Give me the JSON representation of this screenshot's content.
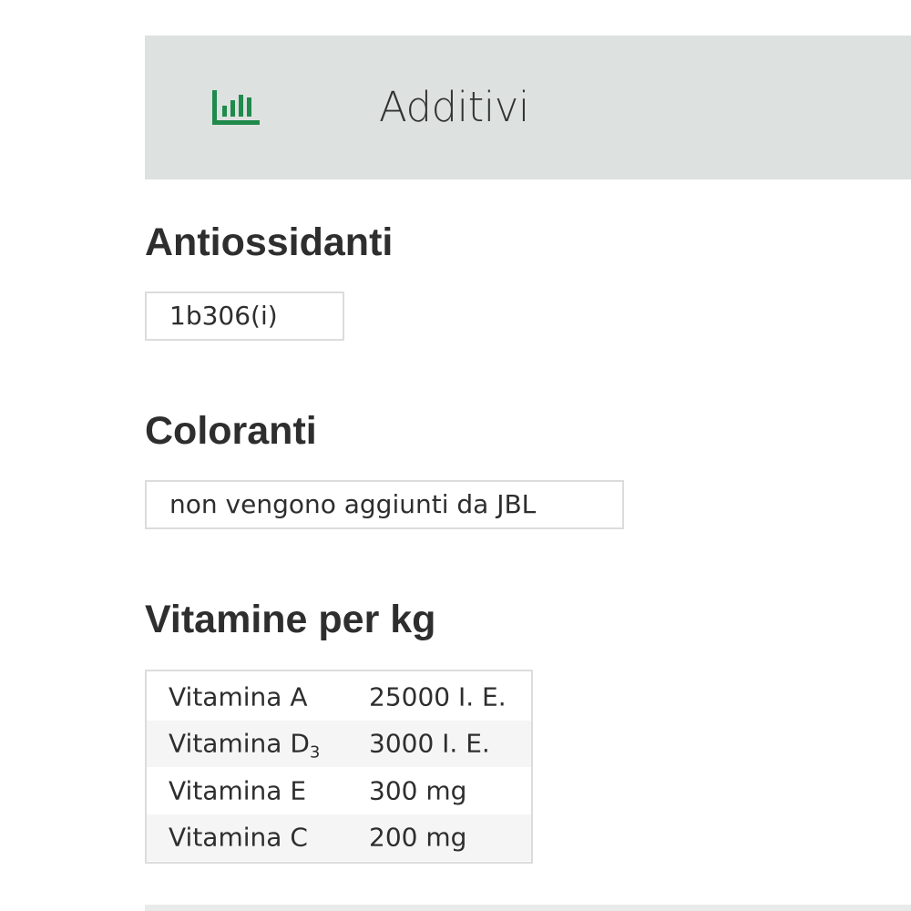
{
  "header": {
    "title": "Additivi",
    "icon": "bar-chart-icon",
    "icon_color": "#1f8a4c",
    "background": "#dde1df"
  },
  "sections": {
    "antioxidants": {
      "heading": "Antiossidanti",
      "value": "1b306(i)"
    },
    "colorants": {
      "heading": "Coloranti",
      "value": "non vengono aggiunti da JBL"
    },
    "vitamins": {
      "heading": "Vitamine per kg",
      "rows": [
        {
          "name": "Vitamina A",
          "amount": "25000 I. E."
        },
        {
          "name": "Vitamina D",
          "subscript": "3",
          "amount": "3000 I. E."
        },
        {
          "name": "Vitamina E",
          "amount": "300 mg"
        },
        {
          "name": "Vitamina C",
          "amount": "200 mg"
        }
      ]
    }
  }
}
